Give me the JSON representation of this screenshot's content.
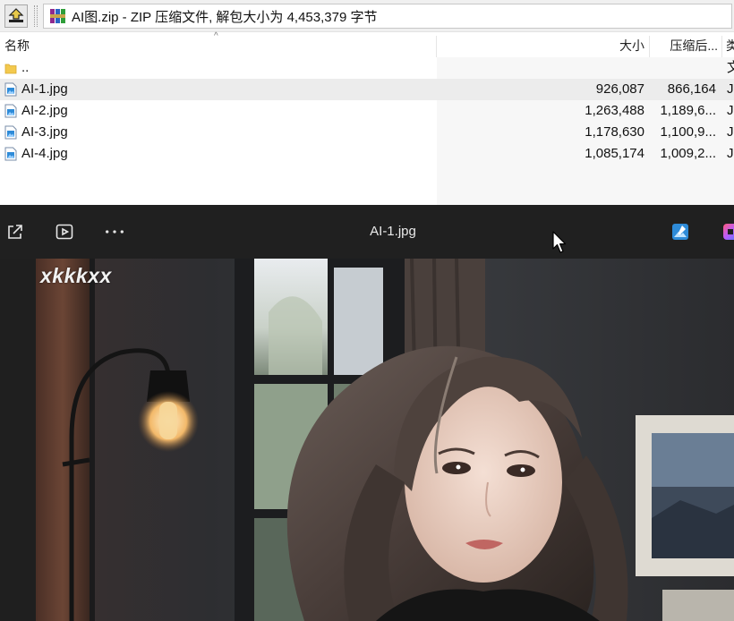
{
  "archive": {
    "path_title": "AI图.zip - ZIP 压缩文件, 解包大小为 4,453,379 字节",
    "columns": {
      "name": "名称",
      "size": "大小",
      "packed": "压缩后...",
      "type": "类"
    },
    "parent_row": {
      "name": "..",
      "type": "文"
    },
    "files": [
      {
        "name": "AI-1.jpg",
        "size": "926,087",
        "packed": "866,164",
        "type": "JP"
      },
      {
        "name": "AI-2.jpg",
        "size": "1,263,488",
        "packed": "1,189,6...",
        "type": "JP"
      },
      {
        "name": "AI-3.jpg",
        "size": "1,178,630",
        "packed": "1,100,9...",
        "type": "JP"
      },
      {
        "name": "AI-4.jpg",
        "size": "1,085,174",
        "packed": "1,009,2...",
        "type": "JP"
      }
    ],
    "selected_index": 0
  },
  "viewer": {
    "title": "AI-1.jpg",
    "watermark": "xkkkxx",
    "toolbar_icons": [
      "share-icon",
      "slideshow-icon",
      "more-icon",
      "edit-photo-icon",
      "app-icon"
    ]
  },
  "colors": {
    "viewer_bg": "#202020",
    "selected_row": "#ececec",
    "accent_blue": "#2e8bd8"
  }
}
